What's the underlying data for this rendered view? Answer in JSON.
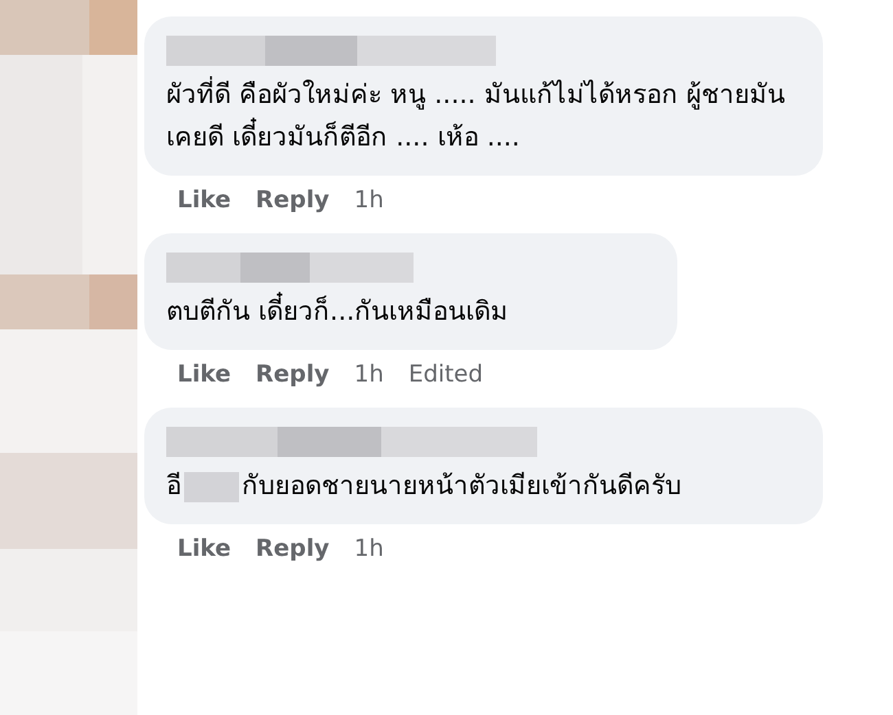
{
  "comments": [
    {
      "segments": [
        {
          "kind": "text",
          "text": "ผัวที่ดี คือผัวใหม่ค่ะ หนู ..... มันแก้ไม่ได้หรอก ผู้ชายมันเคยดี เดี๋ยวมันก็ตีอีก .... เห้อ ...."
        }
      ],
      "actions": {
        "like": "Like",
        "reply": "Reply",
        "time": "1h"
      }
    },
    {
      "segments": [
        {
          "kind": "text",
          "text": "ตบตีกัน เดี๋ยวก็...กันเหมือนเดิม"
        }
      ],
      "actions": {
        "like": "Like",
        "reply": "Reply",
        "time": "1h",
        "edited": "Edited"
      }
    },
    {
      "segments": [
        {
          "kind": "text",
          "text": "อี"
        },
        {
          "kind": "redacted"
        },
        {
          "kind": "text",
          "text": "กับยอดชายนายหน้าตัวเมียเข้ากันดีครับ"
        }
      ],
      "actions": {
        "like": "Like",
        "reply": "Reply",
        "time": "1h"
      }
    }
  ]
}
